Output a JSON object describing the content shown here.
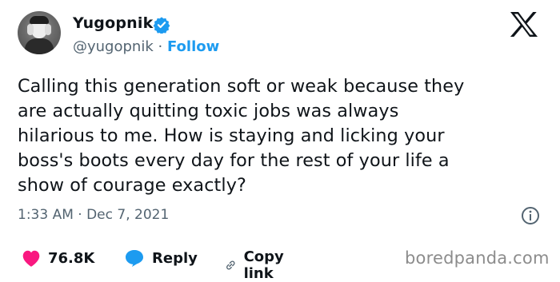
{
  "author": {
    "name": "Yugopnik",
    "handle": "@yugopnik",
    "separator": "·",
    "follow_label": "Follow"
  },
  "tweet": {
    "text": "Calling this generation soft or weak because they\nare actually quitting toxic jobs was always\nhilarious to me. How is staying and licking your\nboss's boots every day for the rest of your life a\nshow of courage exactly?",
    "timestamp": "1:33 AM · Dec 7, 2021"
  },
  "actions": {
    "likes": "76.8K",
    "reply_label": "Reply",
    "copy_link_label": "Copy link"
  },
  "watermark": "boredpanda.com",
  "colors": {
    "accent": "#1d9bf0",
    "heart": "#f91880",
    "secondary_text": "#536471",
    "text": "#0f1419"
  }
}
